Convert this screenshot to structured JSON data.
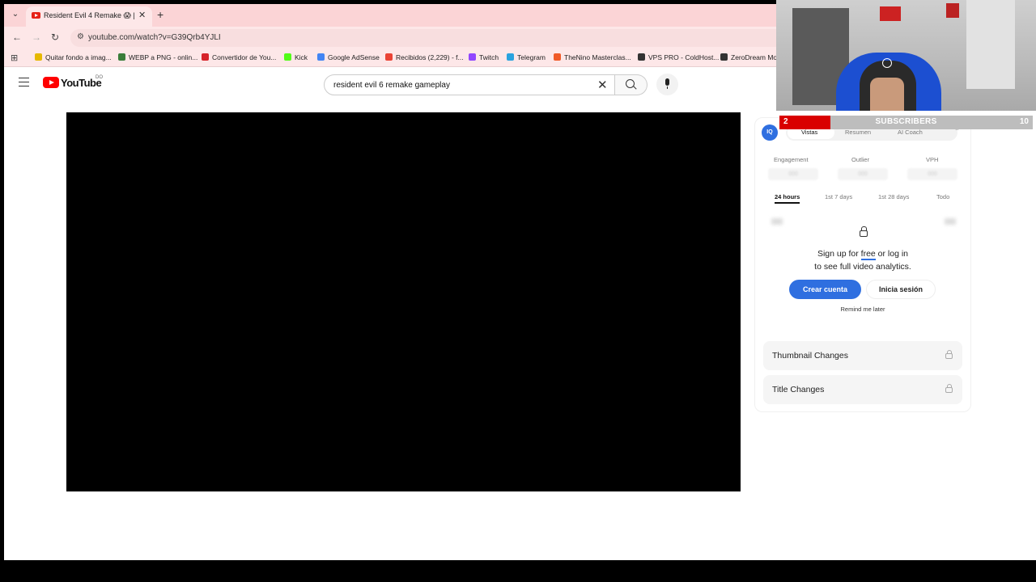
{
  "browser": {
    "tab": {
      "title": "Resident Evil 4 Remake 😱 | El",
      "close": "✕",
      "new_tab": "+"
    },
    "tab_menu": "⌄",
    "nav": {
      "back": "←",
      "forward": "→",
      "reload": "↻"
    },
    "url": "youtube.com/watch?v=G39Qrb4YJLI",
    "bookmarks": [
      {
        "label": "Quitar fondo a imag...",
        "color": "#e6b800"
      },
      {
        "label": "WEBP a PNG - onlin...",
        "color": "#3a7d3a"
      },
      {
        "label": "Convertidor de You...",
        "color": "#d6232a"
      },
      {
        "label": "Kick",
        "color": "#53fc18"
      },
      {
        "label": "Google AdSense",
        "color": "#4285f4"
      },
      {
        "label": "Recibidos (2,229) - f...",
        "color": "#ea4335"
      },
      {
        "label": "Twitch",
        "color": "#9146ff"
      },
      {
        "label": "Telegram",
        "color": "#2aa3df"
      },
      {
        "label": "TheNino Masterclas...",
        "color": "#f05a28"
      },
      {
        "label": "VPS PRO - ColdHost...",
        "color": "#333333"
      },
      {
        "label": "ZeroDream Mo",
        "color": "#333333"
      }
    ]
  },
  "youtube": {
    "wordmark": "YouTube",
    "country": "DO",
    "search_query": "resident evil 6 remake gameplay",
    "search_clear": "✕"
  },
  "analytics": {
    "logo": "IQ",
    "tabs": [
      "Vistas",
      "Resumen",
      "AI Coach"
    ],
    "collapse": "⌃",
    "metrics": [
      {
        "label": "Engagement",
        "value": "000"
      },
      {
        "label": "Outlier",
        "value": "000"
      },
      {
        "label": "VPH",
        "value": "000"
      }
    ],
    "ranges": [
      "24 hours",
      "1st 7 days",
      "1st 28 days",
      "Todo"
    ],
    "signup": {
      "before": "Sign up for ",
      "free": "free",
      "after": " or log in",
      "line2": "to see full video analytics."
    },
    "create_account": "Crear cuenta",
    "login": "Inicia sesión",
    "remind_later": "Remind me later",
    "locked_items": [
      "Thumbnail Changes",
      "Title Changes"
    ]
  },
  "overlay": {
    "subscribers": {
      "current": "2",
      "label": "SUBSCRIBERS",
      "goal": "10",
      "progress": 0.2
    }
  },
  "colors": {
    "accent": "#2f6fe0",
    "youtube_red": "#ff0000",
    "tab_strip": "#fbd4d6",
    "goal_red": "#d90000"
  }
}
